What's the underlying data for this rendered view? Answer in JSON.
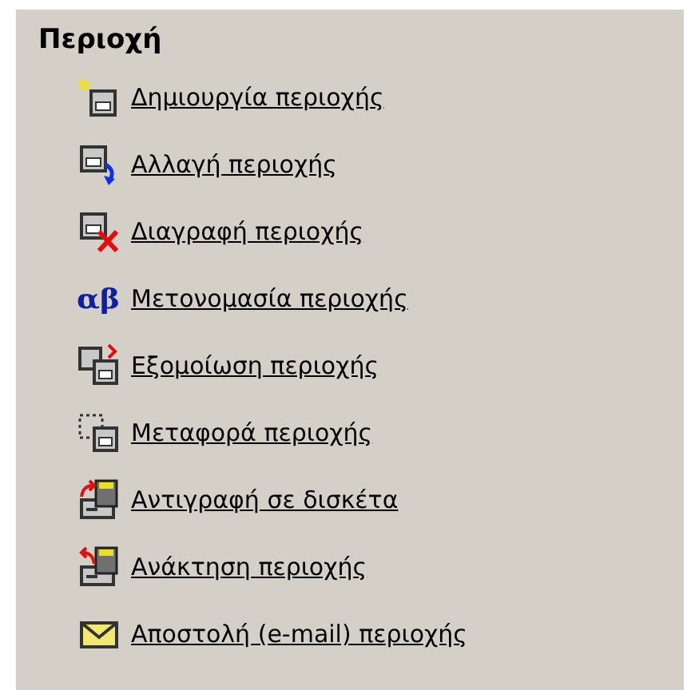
{
  "panel": {
    "title": "Περιοχή",
    "items": [
      {
        "kind": "new",
        "label": "Δημιουργία περιοχής"
      },
      {
        "kind": "change",
        "label": "Αλλαγή περιοχής"
      },
      {
        "kind": "delete",
        "label": "Διαγραφή περιοχής"
      },
      {
        "kind": "rename",
        "label": "Μετονομασία περιοχής",
        "icon_text": "αβ"
      },
      {
        "kind": "compare",
        "label": "Εξομοίωση περιοχής"
      },
      {
        "kind": "move",
        "label": "Μεταφορά περιοχής"
      },
      {
        "kind": "copy",
        "label": "Αντιγραφή σε δισκέτα"
      },
      {
        "kind": "restore",
        "label": "Ανάκτηση περιοχής"
      },
      {
        "kind": "email",
        "label": "Αποστολή (e-mail) περιοχής"
      }
    ]
  }
}
